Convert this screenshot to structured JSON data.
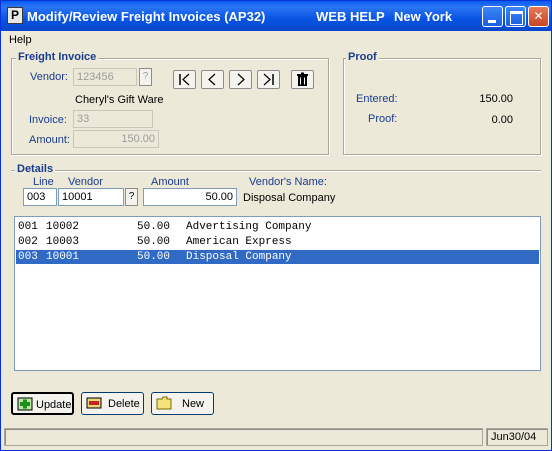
{
  "window": {
    "title": "Modify/Review Freight Invoices (AP32)",
    "web_help": "WEB HELP",
    "location": "New York",
    "app_icon_letter": "P"
  },
  "menu": {
    "help": "Help"
  },
  "freight_invoice": {
    "group_label": "Freight Invoice",
    "vendor_label": "Vendor:",
    "vendor_value": "123456",
    "vendor_lookup": "?",
    "vendor_name": "Cheryl's Gift Ware",
    "invoice_label": "Invoice:",
    "invoice_value": "33",
    "amount_label": "Amount:",
    "amount_value": "150.00"
  },
  "proof": {
    "group_label": "Proof",
    "entered_label": "Entered:",
    "entered_value": "150.00",
    "proof_label": "Proof:",
    "proof_value": "0.00"
  },
  "details": {
    "group_label": "Details",
    "line_label": "Line",
    "vendor_label": "Vendor",
    "amount_label": "Amount",
    "vendor_name_label": "Vendor's Name:",
    "line_value": "003",
    "vendor_value": "10001",
    "vendor_lookup": "?",
    "amount_value": "50.00",
    "vendor_name_value": "Disposal Company"
  },
  "list": {
    "rows": [
      {
        "line": "001",
        "vendor": "10002",
        "amount": "50.00",
        "name": "Advertising Company",
        "selected": false
      },
      {
        "line": "002",
        "vendor": "10003",
        "amount": "50.00",
        "name": "American Express",
        "selected": false
      },
      {
        "line": "003",
        "vendor": "10001",
        "amount": "50.00",
        "name": "Disposal Company",
        "selected": true
      }
    ]
  },
  "buttons": {
    "update": "Update",
    "delete": "Delete",
    "new": "New"
  },
  "status": {
    "date": "Jun30/04"
  },
  "colors": {
    "selection": "#316ac5",
    "label_blue": "#1a3c8c",
    "title_bar": "#0a5bef"
  }
}
